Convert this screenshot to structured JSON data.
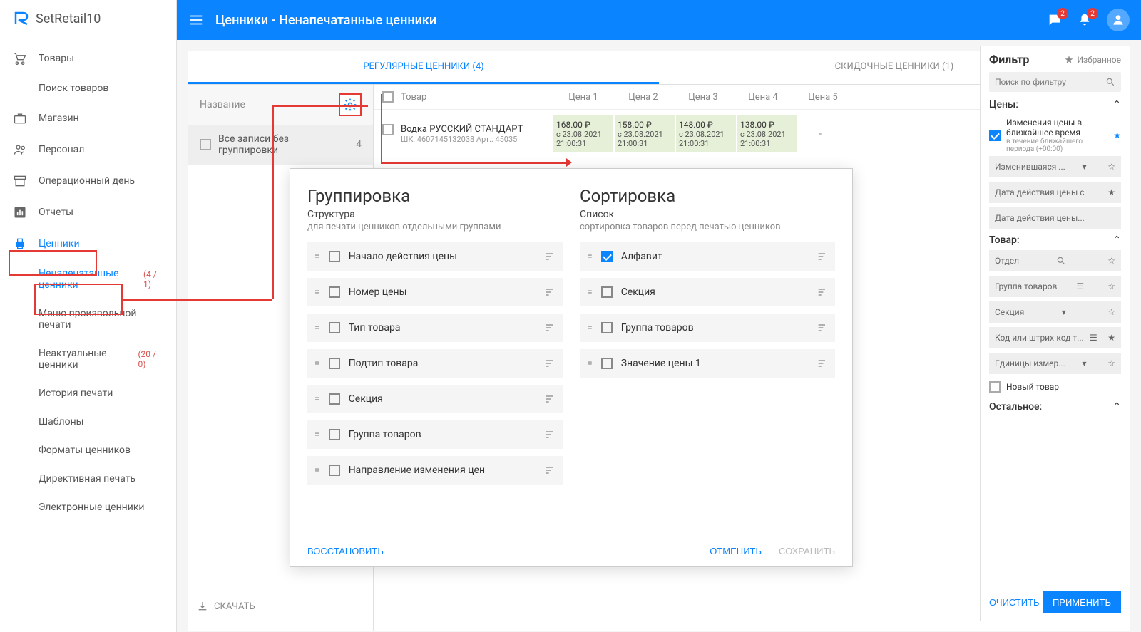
{
  "app": {
    "name": "SetRetail10"
  },
  "header": {
    "title": "Ценники - Ненапечатанные ценники",
    "badge_messages": "2",
    "badge_notifications": "2"
  },
  "sidebar": {
    "items": {
      "products": "Товары",
      "search_products": "Поиск товаров",
      "store": "Магазин",
      "staff": "Персонал",
      "opday": "Операционный день",
      "reports": "Отчеты",
      "pricetags": "Ценники"
    },
    "pt_sub": {
      "unprinted": "Ненапечатанные ценники",
      "unprinted_count": "(4 / 1)",
      "custom_menu": "Меню произвольной печати",
      "outdated": "Неактуальные ценники",
      "outdated_count": "(20 / 0)",
      "history": "История печати",
      "templates": "Шаблоны",
      "formats": "Форматы ценников",
      "directive": "Директивная печать",
      "electronic": "Электронные ценники"
    }
  },
  "tabs": {
    "regular": "РЕГУЛЯРНЫЕ ЦЕННИКИ (4)",
    "discount": "СКИДОЧНЫЕ ЦЕННИКИ (1)"
  },
  "table": {
    "name_header": "Название",
    "all_no_group": "Все записи без группировки",
    "all_no_group_cnt": "4",
    "col_product": "Товар",
    "col_p1": "Цена 1",
    "col_p2": "Цена 2",
    "col_p3": "Цена 3",
    "col_p4": "Цена 4",
    "col_p5": "Цена 5",
    "row1": {
      "name": "Водка РУССКИЙ СТАНДАРТ",
      "sub": "ШК: 4607145132038   Арт.: 45035",
      "p1": {
        "v": "168.00 ₽",
        "d": "с 23.08.2021 21:00:31"
      },
      "p2": {
        "v": "158.00 ₽",
        "d": "с 23.08.2021 21:00:31"
      },
      "p3": {
        "v": "148.00 ₽",
        "d": "с 23.08.2021 21:00:31"
      },
      "p4": {
        "v": "138.00 ₽",
        "d": "с 23.08.2021 21:00:31"
      },
      "p5": "-"
    }
  },
  "download": "СКАЧАТЬ",
  "modal": {
    "group_title": "Группировка",
    "group_sub1": "Структура",
    "group_sub2": "для печати ценников отдельными группами",
    "group_items": [
      "Начало действия цены",
      "Номер цены",
      "Тип товара",
      "Подтип товара",
      "Секция",
      "Группа товаров",
      "Направление изменения цен"
    ],
    "sort_title": "Сортировка",
    "sort_sub1": "Список",
    "sort_sub2": "сортировка товаров перед печатью ценников",
    "sort_items": [
      {
        "label": "Алфавит",
        "checked": true
      },
      {
        "label": "Секция",
        "checked": false
      },
      {
        "label": "Группа товаров",
        "checked": false
      },
      {
        "label": "Значение цены 1",
        "checked": false
      }
    ],
    "restore": "ВОССТАНОВИТЬ",
    "cancel": "ОТМЕНИТЬ",
    "save": "СОХРАНИТЬ"
  },
  "filter": {
    "title": "Фильтр",
    "fav": "Избранное",
    "search_ph": "Поиск по фильтру",
    "prices_title": "Цены:",
    "price_soon": "Изменения цены в ближайшее время",
    "price_soon_sub": "в течение ближайшего периода (+00:00)",
    "changed": "Изменившаяся ...",
    "date_from": "Дата действия цены с",
    "date_to": "Дата действия цены...",
    "product_title": "Товар:",
    "department": "Отдел",
    "group": "Группа товаров",
    "section": "Секция",
    "code": "Код или штрих-код т...",
    "units": "Единицы измер...",
    "new_product": "Новый товар",
    "other_title": "Остальное:",
    "clear": "ОЧИСТИТЬ",
    "apply": "ПРИМЕНИТЬ"
  }
}
